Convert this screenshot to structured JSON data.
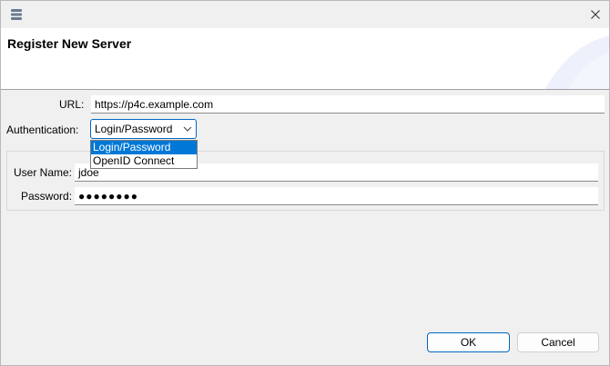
{
  "titlebar": {
    "app_icon": "stack-icon",
    "close_icon": "close-icon"
  },
  "banner": {
    "title": "Register New Server"
  },
  "form": {
    "url_label": "URL:",
    "url_value": "https://p4c.example.com",
    "auth_label": "Authentication:",
    "auth_value": "Login/Password",
    "auth_options": [
      "Login/Password",
      "OpenID Connect"
    ],
    "auth_selected_index": 0,
    "username_label": "User Name:",
    "username_value": "jdoe",
    "password_label": "Password:",
    "password_value": "●●●●●●●●"
  },
  "buttons": {
    "ok_label": "OK",
    "cancel_label": "Cancel"
  },
  "colors": {
    "accent": "#0067c0",
    "selection": "#0078d7"
  }
}
